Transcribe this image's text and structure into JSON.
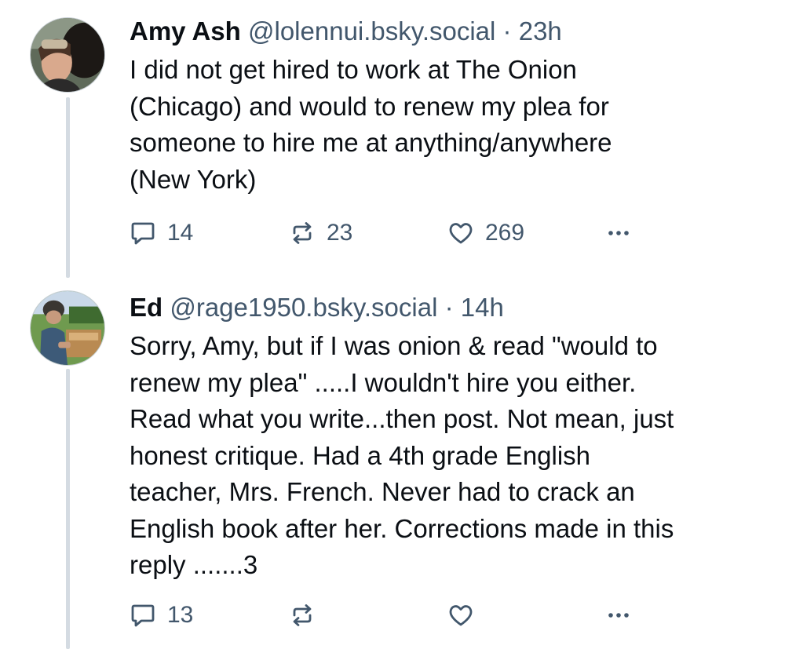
{
  "posts": [
    {
      "display_name": "Amy Ash",
      "handle": "@lolennui.bsky.social",
      "separator": "·",
      "timestamp": "23h",
      "text": "I did not get hired to work at The Onion\n(Chicago) and would to renew my plea for\nsomeone to hire me at anything/anywhere\n(New York)",
      "reply_count": "14",
      "repost_count": "23",
      "like_count": "269"
    },
    {
      "display_name": "Ed",
      "handle": "@rage1950.bsky.social",
      "separator": "·",
      "timestamp": "14h",
      "text": "Sorry, Amy, but if I was onion & read \"would to\nrenew my plea\" .....I wouldn't hire you either.\nRead what you write...then post. Not mean, just\nhonest critique. Had a 4th grade English\nteacher, Mrs. French. Never had to crack an\nEnglish book after her. Corrections made in this\nreply .......3",
      "reply_count": "13",
      "repost_count": "",
      "like_count": ""
    }
  ],
  "icons": {
    "reply": "reply-bubble-icon",
    "repost": "repost-arrows-icon",
    "like": "heart-icon",
    "more": "more-dots-icon"
  },
  "colors": {
    "text": "#0b0f14",
    "muted": "#42576c",
    "thread_line": "#d4dbe2",
    "background": "#ffffff"
  }
}
